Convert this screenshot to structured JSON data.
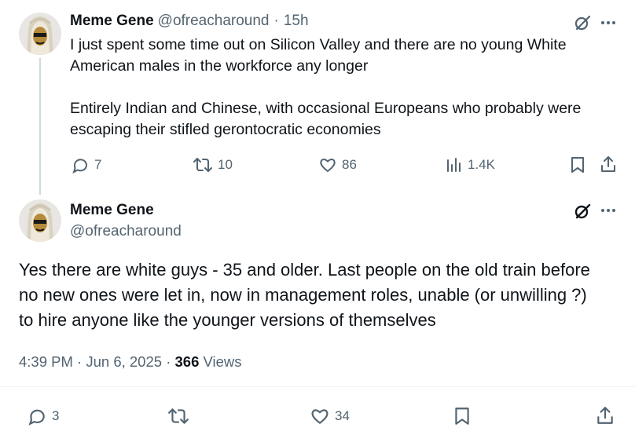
{
  "reply": {
    "author_name": "Meme Gene",
    "author_handle": "@ofreacharound",
    "separator": "·",
    "time_ago": "15h",
    "text": "I just spent some time out on Silicon Valley and there are no young White\nAmerican males in the workforce any longer\n\nEntirely Indian and Chinese, with occasional Europeans who probably were\nescaping their stifled gerontocratic economies",
    "replies": "7",
    "reposts": "10",
    "likes": "86",
    "views": "1.4K"
  },
  "main": {
    "author_name": "Meme Gene",
    "author_handle": "@ofreacharound",
    "text": "Yes there are white guys - 35 and older. Last people on the old train before no new ones were let in, now in management roles, unable (or unwilling ?) to hire anyone like the younger versions of themselves",
    "time": "4:39 PM",
    "date": "Jun 6, 2025",
    "separator": "·",
    "views_count": "366",
    "views_label": "Views",
    "replies": "3",
    "likes": "34"
  },
  "icons": {
    "reply": "comment-icon",
    "repost": "repost-icon",
    "like": "heart-icon",
    "views": "analytics-icon",
    "bookmark": "bookmark-icon",
    "share": "share-icon",
    "grok": "grok-icon",
    "more": "more-icon"
  },
  "colors": {
    "text": "#0f1419",
    "secondary": "#536471",
    "thread_line": "#cfd9de"
  }
}
